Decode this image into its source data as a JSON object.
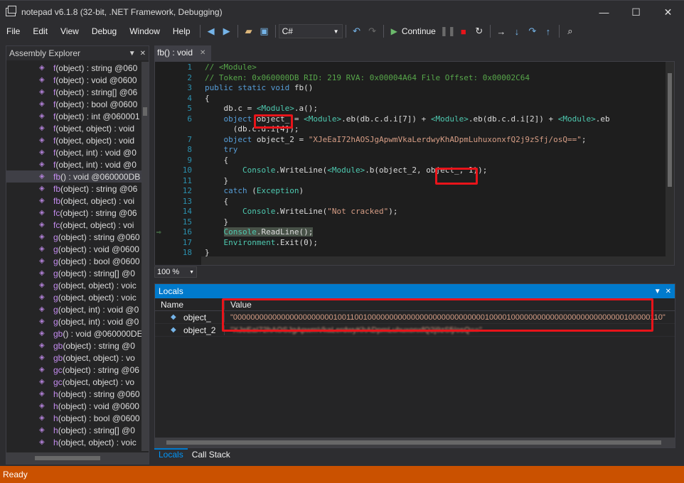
{
  "window": {
    "title": "notepad v6.1.8 (32-bit, .NET Framework, Debugging)",
    "minimize": "—",
    "maximize": "☐",
    "close": "✕"
  },
  "menu": [
    "File",
    "Edit",
    "View",
    "Debug",
    "Window",
    "Help"
  ],
  "toolbar": {
    "language": "C#",
    "continue_label": "Continue"
  },
  "assembly_explorer": {
    "title": "Assembly Explorer",
    "items": [
      {
        "name": "f",
        "rest": "(object) : string @060"
      },
      {
        "name": "f",
        "rest": "(object) : void @0600"
      },
      {
        "name": "f",
        "rest": "(object) : string[] @06"
      },
      {
        "name": "f",
        "rest": "(object) : bool @0600"
      },
      {
        "name": "f",
        "rest": "(object) : int @060001"
      },
      {
        "name": "f",
        "rest": "(object, object) : void"
      },
      {
        "name": "f",
        "rest": "(object, object) : void"
      },
      {
        "name": "f",
        "rest": "(object, int) : void @0"
      },
      {
        "name": "f",
        "rest": "(object, int) : void @0"
      },
      {
        "name": "fb",
        "rest": "() : void @060000DB"
      },
      {
        "name": "fb",
        "rest": "(object) : string @06"
      },
      {
        "name": "fb",
        "rest": "(object, object) : voi"
      },
      {
        "name": "fc",
        "rest": "(object) : string @06"
      },
      {
        "name": "fc",
        "rest": "(object, object) : voi"
      },
      {
        "name": "g",
        "rest": "(object) : string @060"
      },
      {
        "name": "g",
        "rest": "(object) : void @0600"
      },
      {
        "name": "g",
        "rest": "(object) : bool @0600"
      },
      {
        "name": "g",
        "rest": "(object) : string[] @0"
      },
      {
        "name": "g",
        "rest": "(object, object) : voic"
      },
      {
        "name": "g",
        "rest": "(object, object) : voic"
      },
      {
        "name": "g",
        "rest": "(object, int) : void @0"
      },
      {
        "name": "g",
        "rest": "(object, int) : void @0"
      },
      {
        "name": "gb",
        "rest": "() : void @060000DE"
      },
      {
        "name": "gb",
        "rest": "(object) : string @0"
      },
      {
        "name": "gb",
        "rest": "(object, object) : vo"
      },
      {
        "name": "gc",
        "rest": "(object) : string @06"
      },
      {
        "name": "gc",
        "rest": "(object, object) : vo"
      },
      {
        "name": "h",
        "rest": "(object) : string @060"
      },
      {
        "name": "h",
        "rest": "(object) : void @0600"
      },
      {
        "name": "h",
        "rest": "(object) : bool @0600"
      },
      {
        "name": "h",
        "rest": "(object) : string[] @0"
      },
      {
        "name": "h",
        "rest": "(object, object) : voic"
      }
    ]
  },
  "editor": {
    "tab_label": "fb() : void",
    "tab_close": "✕",
    "line_numbers": [
      "1",
      "2",
      "3",
      "4",
      "5",
      "6",
      "",
      "7",
      "8",
      "9",
      "10",
      "11",
      "12",
      "13",
      "14",
      "15",
      "16",
      "17",
      "18"
    ],
    "zoom": "100 %"
  },
  "locals": {
    "title": "Locals",
    "col_name": "Name",
    "col_value": "Value",
    "rows": [
      {
        "name": "object_",
        "value": "\"000000000000000000000001001100100000000000000000000000000010000100000000000000000000000000100000110\""
      },
      {
        "name": "object_2",
        "value": "\"XJeEaI72hAOSJgApwmVkaLerdwyKhADpmLuhuxonxfQ2j9zSfj/osQ==\""
      }
    ]
  },
  "bottom_tabs": [
    "Locals",
    "Call Stack"
  ],
  "status": "Ready"
}
